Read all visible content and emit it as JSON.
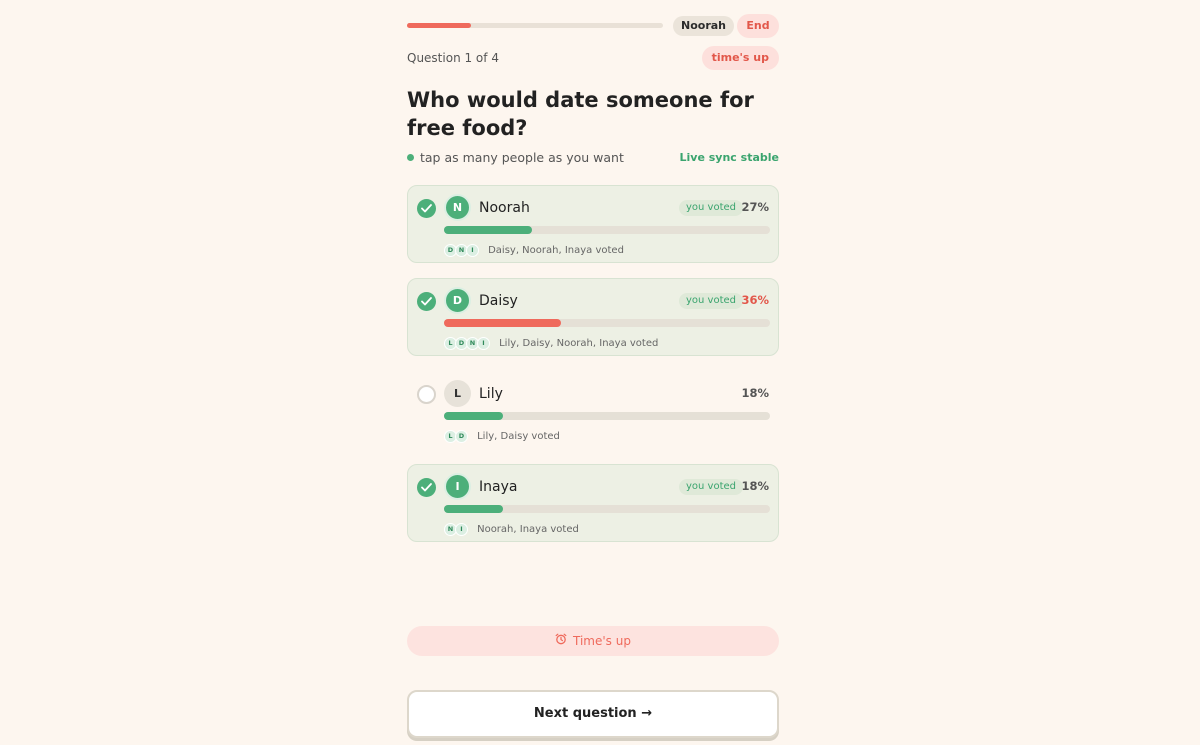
{
  "header": {
    "progress": 0.25,
    "player": "Noorah",
    "end_label": "End",
    "question_count": "Question 1 of 4",
    "timer_label": "time's up"
  },
  "question": {
    "text": "Who would date someone for free food?",
    "hint": "tap as many people as you want",
    "sync_status": "Live sync stable"
  },
  "colors": {
    "accent_green": "#4caf7a",
    "accent_red": "#ef6a5c",
    "background": "#fdf6ef"
  },
  "options": [
    {
      "initial": "N",
      "name": "Noorah",
      "selected": true,
      "badge": "you voted",
      "percent": "27%",
      "fill": 0.27,
      "highlight": false,
      "voter_initials": [
        "D",
        "N",
        "I"
      ],
      "voters_text": "Daisy, Noorah, Inaya voted"
    },
    {
      "initial": "D",
      "name": "Daisy",
      "selected": true,
      "badge": "you voted",
      "percent": "36%",
      "fill": 0.36,
      "highlight": true,
      "voter_initials": [
        "L",
        "D",
        "N",
        "I"
      ],
      "voters_text": "Lily, Daisy, Noorah, Inaya voted"
    },
    {
      "initial": "L",
      "name": "Lily",
      "selected": false,
      "badge": "",
      "percent": "18%",
      "fill": 0.18,
      "highlight": false,
      "voter_initials": [
        "L",
        "D"
      ],
      "voters_text": "Lily, Daisy voted"
    },
    {
      "initial": "I",
      "name": "Inaya",
      "selected": true,
      "badge": "you voted",
      "percent": "18%",
      "fill": 0.18,
      "highlight": false,
      "voter_initials": [
        "N",
        "I"
      ],
      "voters_text": "Noorah, Inaya voted"
    }
  ],
  "footer": {
    "timesup_banner": "Time's up",
    "timesup_icon": "alarm-clock-icon",
    "next_label": "Next question →"
  }
}
